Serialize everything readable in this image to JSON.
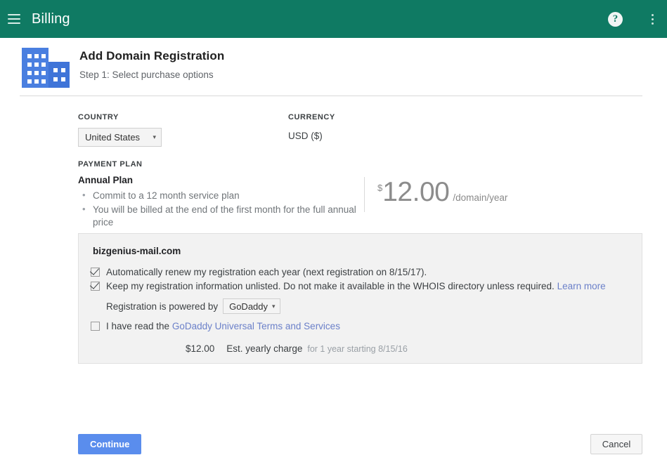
{
  "appbar": {
    "menu_icon": "hamburger-menu-icon",
    "title": "Billing",
    "help_icon": "?",
    "overflow_icon": "kebab-menu-icon",
    "background_color": "#0f7a63"
  },
  "header": {
    "icon": "office-building-icon",
    "title": "Add Domain Registration",
    "subtitle": "Step 1: Select purchase options"
  },
  "form": {
    "country": {
      "label": "COUNTRY",
      "value": "United States",
      "caret": "▾"
    },
    "currency": {
      "label": "CURRENCY",
      "value": "USD ($)"
    }
  },
  "payment_plan": {
    "label": "PAYMENT PLAN",
    "name": "Annual Plan",
    "bullets": [
      "Commit to a 12 month service plan",
      "You will be billed at the end of the first month for the full annual price"
    ],
    "price": {
      "currency_symbol": "$",
      "amount": "12.00",
      "unit": "/domain/year"
    }
  },
  "domain_card": {
    "domain": "bizgenius-mail.com",
    "auto_renew": {
      "checked": true,
      "text": "Automatically renew my registration each year (next registration on 8/15/17)."
    },
    "privacy": {
      "checked": true,
      "text": "Keep my registration information unlisted. Do not make it available in the WHOIS directory unless required.",
      "link_label": "Learn more"
    },
    "powered_by": {
      "label": "Registration is powered by",
      "value": "GoDaddy",
      "caret": "▾"
    },
    "terms": {
      "checked": false,
      "text": "I have read the",
      "link_label": "GoDaddy Universal Terms and Services"
    },
    "charge": {
      "amount": "$12.00",
      "label": "Est. yearly charge",
      "note": "for 1 year starting 8/15/16"
    }
  },
  "footer": {
    "continue_label": "Continue",
    "cancel_label": "Cancel",
    "continue_color": "#5a8ded"
  }
}
